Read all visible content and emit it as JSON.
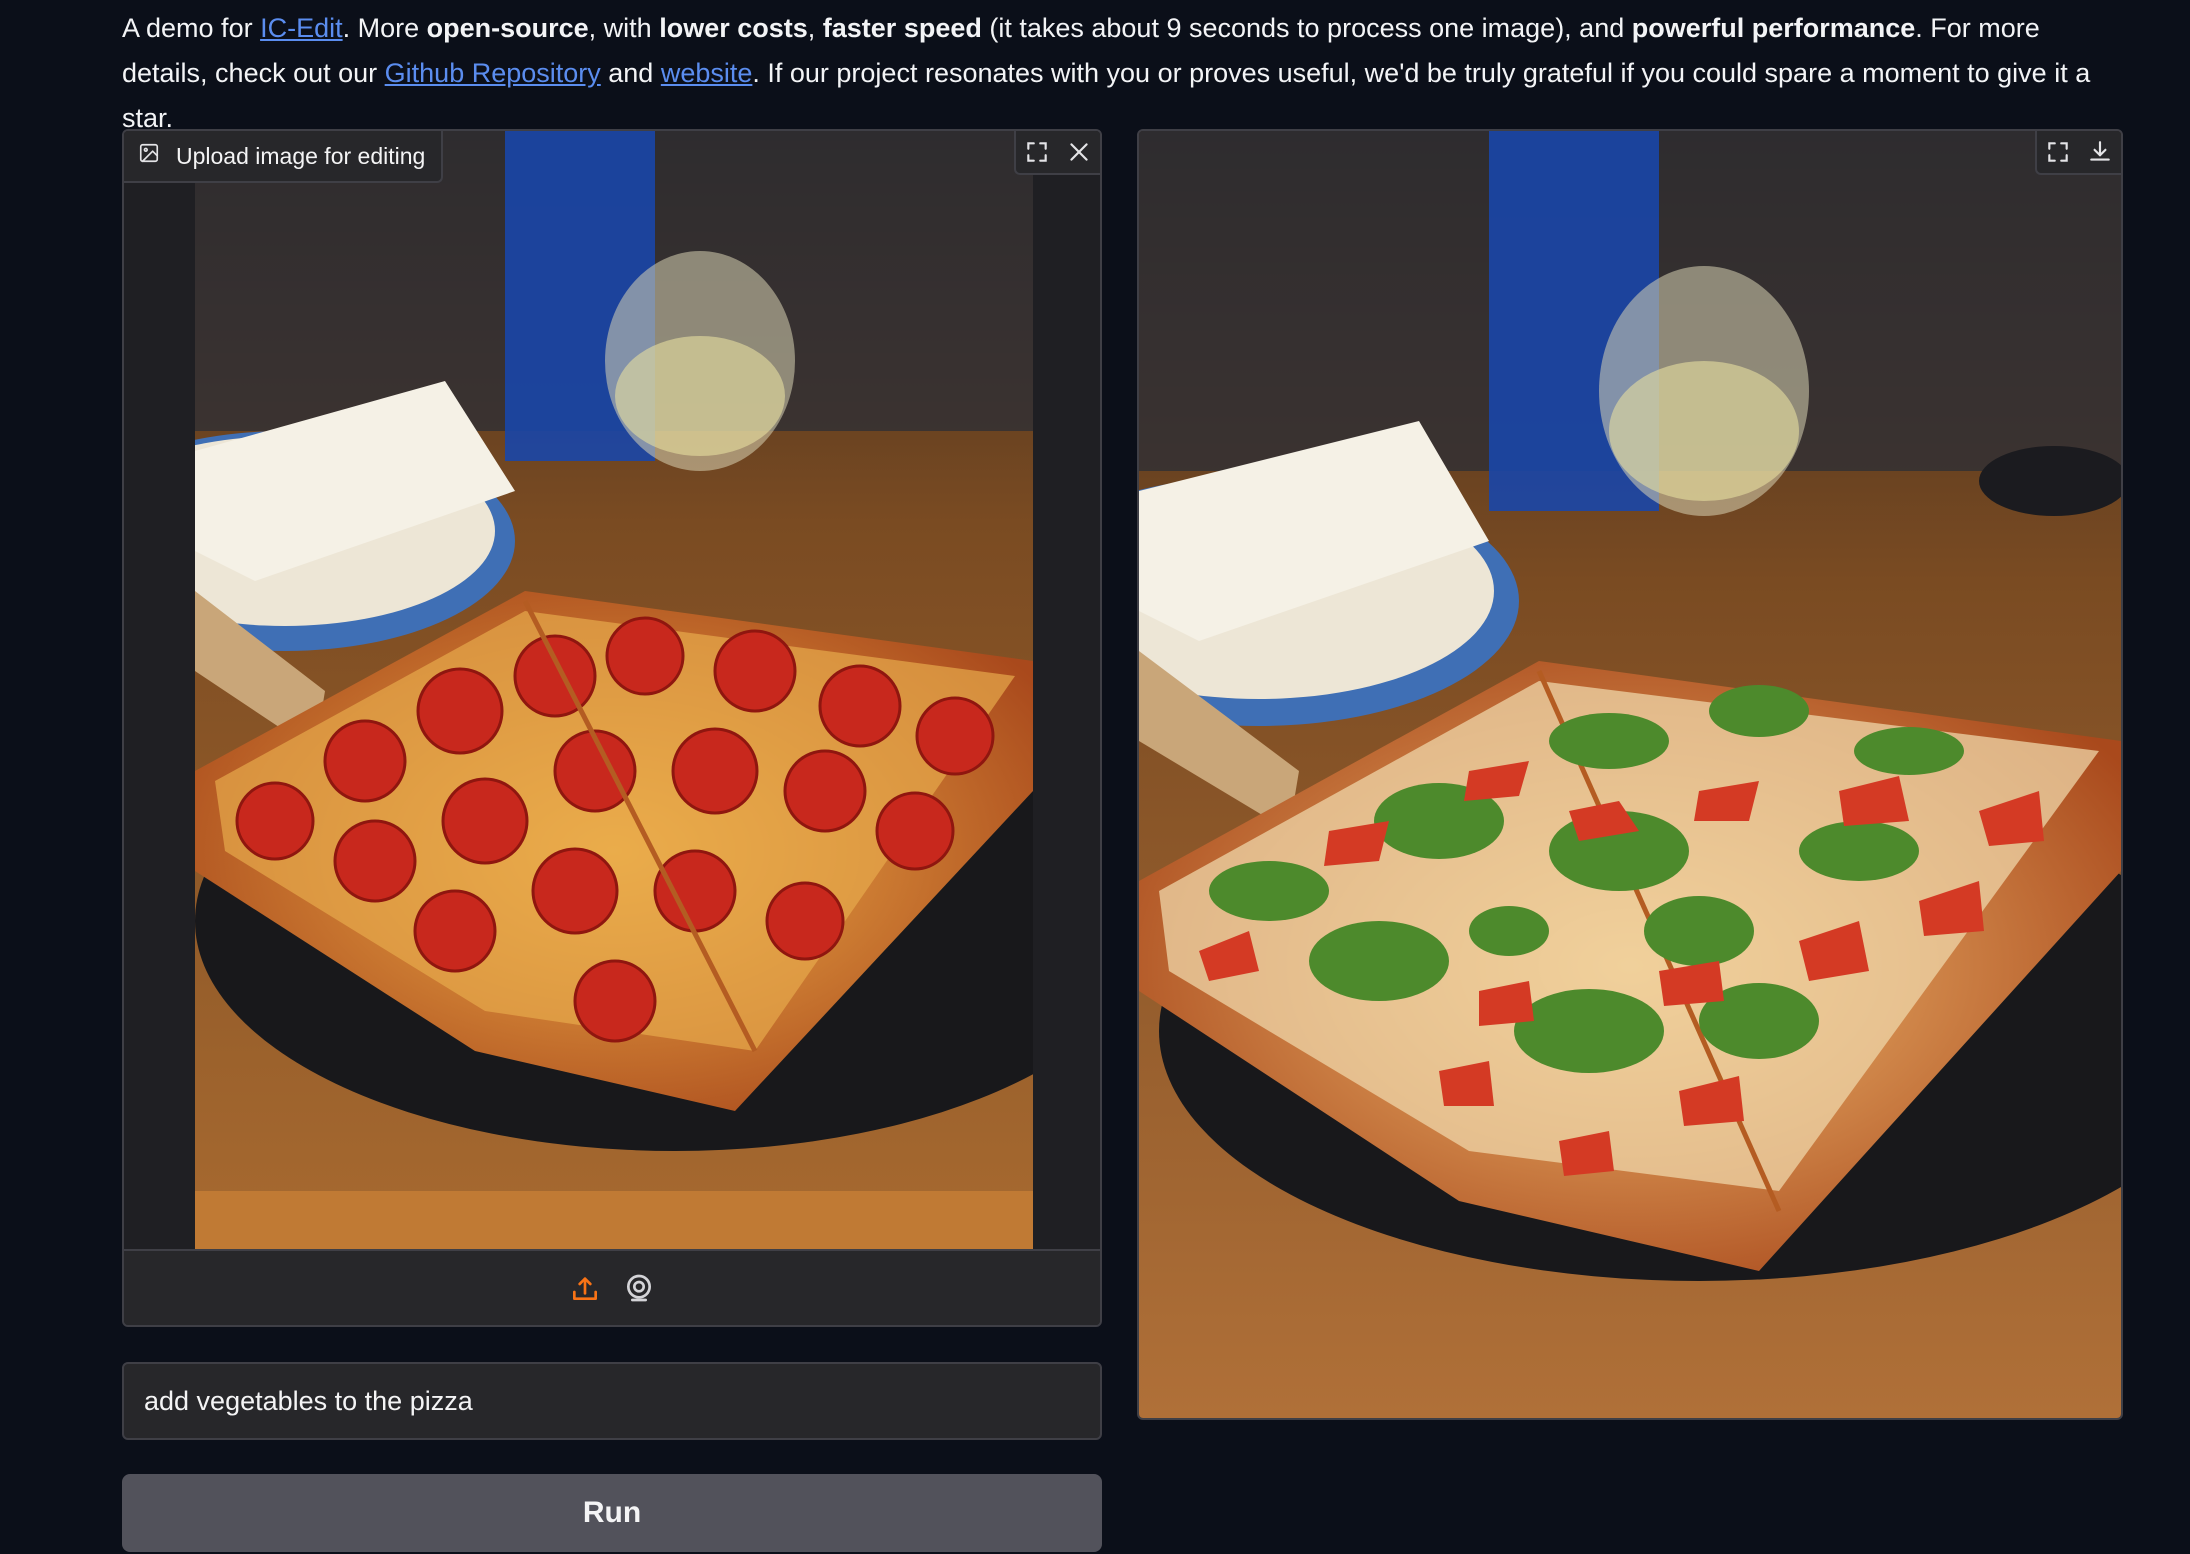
{
  "intro": {
    "p1": "A demo for ",
    "link_ic_edit": "IC-Edit",
    "p2": ". More ",
    "b_open_source": "open-source",
    "p3": ", with ",
    "b_lower_costs": "lower costs",
    "p4": ", ",
    "b_faster_speed": "faster speed",
    "p5": " (it takes about 9 seconds to process one image), and ",
    "b_powerful": "powerful performance",
    "p6": ". For more details, check out our ",
    "link_github": "Github Repository",
    "p7": " and ",
    "link_website": "website",
    "p8": ". If our project resonates with you or proves useful, we'd be truly grateful if you could spare a moment to give it a star."
  },
  "input_image": {
    "label": "Upload image for editing",
    "label_icon": "image-icon",
    "top_icons": [
      "fullscreen-icon",
      "close-icon"
    ],
    "footer_icons": [
      "upload-icon",
      "webcam-icon"
    ]
  },
  "prompt": {
    "value": "add vegetables to the pizza"
  },
  "run_button": {
    "label": "Run"
  },
  "output_image": {
    "top_icons": [
      "fullscreen-icon",
      "download-icon"
    ]
  },
  "colors": {
    "background": "#0b0f19",
    "panel": "#27272a",
    "border": "#3f3f46",
    "link": "#5b8def",
    "accent_upload": "#f97316",
    "run_button": "#52525b"
  }
}
